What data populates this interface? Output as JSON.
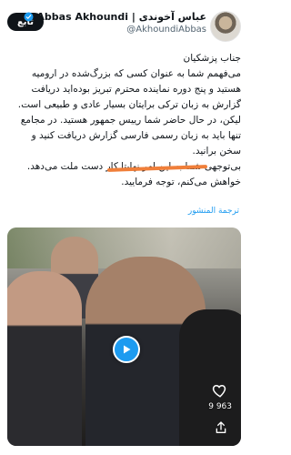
{
  "header": {
    "follow_label": "تابع",
    "display_name": "Abbas Akhoundi | عباس آخوندی",
    "handle": "@AkhoundiAbbas"
  },
  "tweet": {
    "lines": [
      "جناب پزشکیان",
      "می‌فهمم شما به عنوان کسی که بزرگ‌شده در ارومیه",
      "هستید و پنج دوره نماینده محترم تبریز بوده‌اید دریافت",
      "گزارش به زبان ترکی برایتان بسیار عادی و طبیعی است.",
      "لیکن، در حال حاضر شما رییس جمهور هستید. در مجامع",
      "تنها باید به زبان رسمی فارسی گزارش دریافت کنید و",
      "سخن برانید.",
      "بی‌توجهی شما به این امر نهایتا کار دست ملت می‌دهد.",
      "خواهش می‌کنم، توجه فرمایید."
    ],
    "translate_label": "ترجمة المنشور"
  },
  "media": {
    "like_count": "9 963"
  },
  "colors": {
    "accent": "#1d9bf0",
    "highlight": "#f07f3a"
  }
}
